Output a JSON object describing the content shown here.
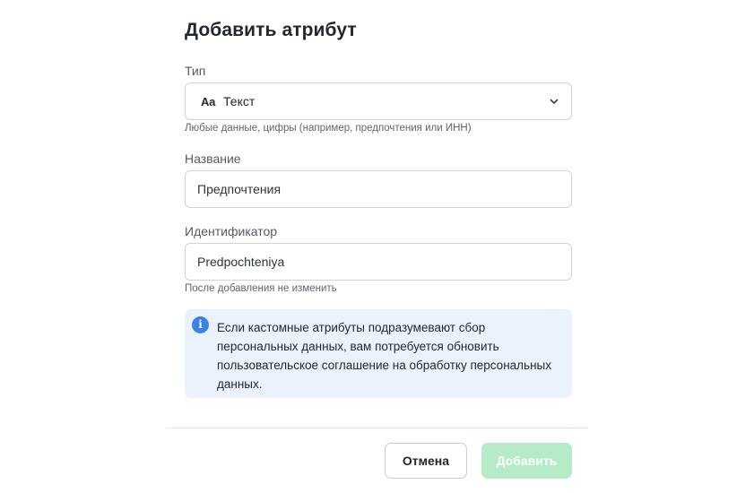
{
  "dialog": {
    "title": "Добавить атрибут"
  },
  "type_field": {
    "label": "Тип",
    "icon": "Aa",
    "value": "Текст",
    "hint": "Любые данные, цифры (например, предпочтения или ИНН)"
  },
  "name_field": {
    "label": "Название",
    "value": "Предпочтения"
  },
  "id_field": {
    "label": "Идентификатор",
    "value": "Predpochteniya",
    "hint": "После добавления не изменить"
  },
  "info": {
    "icon": "i",
    "text": "Если кастомные атрибуты подразумевают сбор персональных данных, вам потребуется обновить пользовательское соглашение на обработку персональных данных."
  },
  "footer": {
    "cancel_label": "Отмена",
    "add_label": "Добавить"
  },
  "colors": {
    "accent_info": "#3b82e6",
    "info_bg": "#ebf2fd",
    "add_button_disabled": "#b5ebc6"
  }
}
